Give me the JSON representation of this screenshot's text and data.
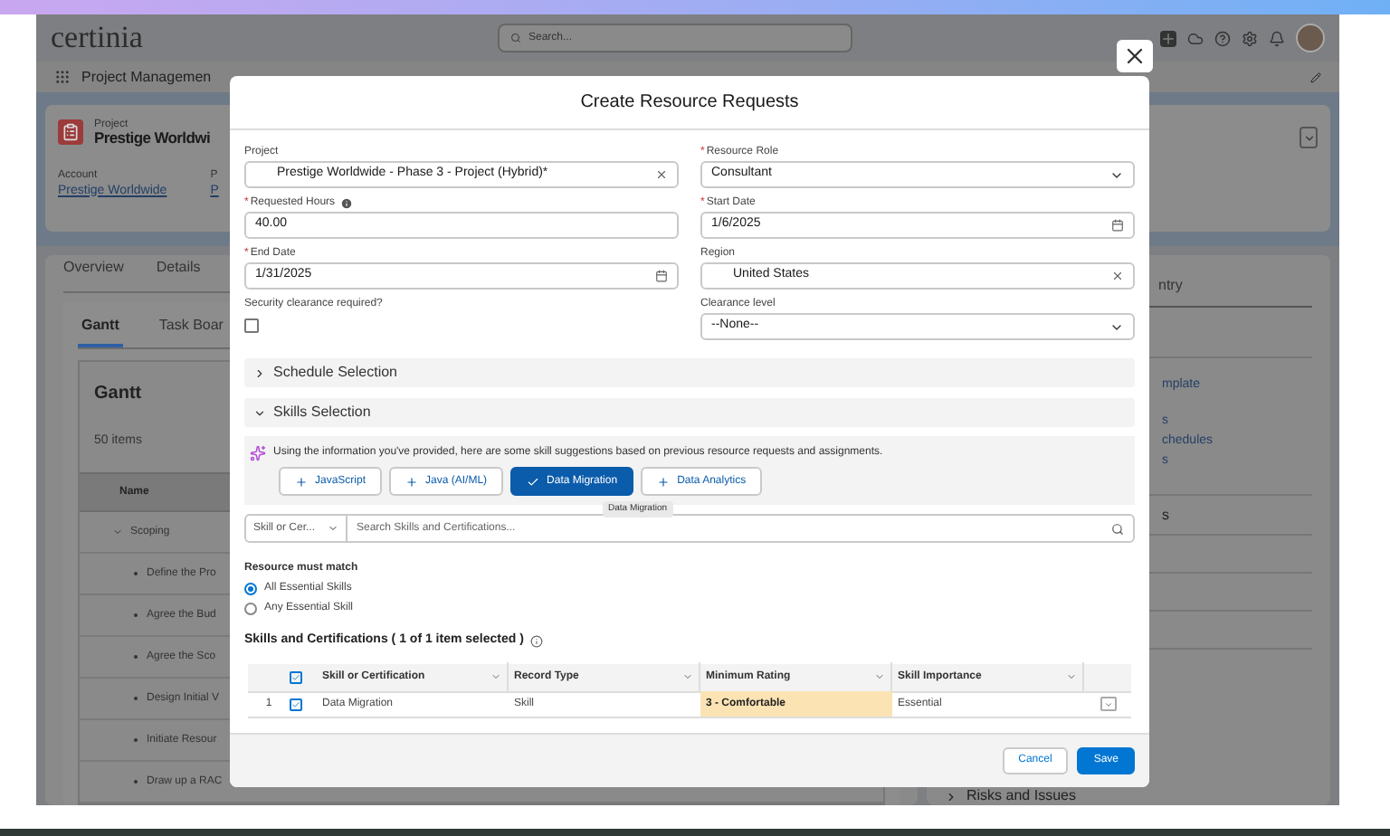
{
  "top_bar": {
    "logo": "certinia",
    "search": {
      "placeholder": "Search..."
    }
  },
  "nav": {
    "app_name": "Project Managemen"
  },
  "record_header": {
    "object_label": "Project",
    "title": "Prestige Worldwi",
    "fields": [
      {
        "label": "Account",
        "value": "Prestige Worldwide"
      },
      {
        "label": "P",
        "value": "P"
      }
    ]
  },
  "left_panel": {
    "tabs": [
      "Overview",
      "Details"
    ],
    "subtabs": [
      {
        "label": "Gantt",
        "selected": true
      },
      {
        "label": "Task Boar",
        "selected": false
      }
    ],
    "gantt": {
      "title": "Gantt",
      "count": "50 items",
      "column": "Name",
      "rows": [
        {
          "name": "Scoping",
          "expanded": true,
          "children": [
            {
              "name": "Define the Pro"
            },
            {
              "name": "Agree the Bud"
            },
            {
              "name": "Agree the Sco"
            },
            {
              "name": "Design Initial V"
            },
            {
              "name": "Initiate Resour"
            },
            {
              "name": "Draw up a RAC"
            }
          ]
        }
      ]
    }
  },
  "right_panel": {
    "tab": "ntry",
    "items": [
      {
        "kind": "link",
        "text": "mplate"
      },
      {
        "kind": "link",
        "text": "s"
      },
      {
        "kind": "link",
        "text": "chedules"
      },
      {
        "kind": "link",
        "text": "s"
      },
      {
        "kind": "heading",
        "text": "s"
      }
    ],
    "section": "Risks and Issues"
  },
  "modal": {
    "title": "Create Resource Requests",
    "fields": [
      {
        "kind": "lookup",
        "label": "Project",
        "value": "Prestige Worldwide - Phase 3 - Project (Hybrid)*"
      },
      {
        "kind": "select",
        "label": "Resource Role",
        "required_mark": "*",
        "value": "Consultant"
      },
      {
        "kind": "text",
        "label": "Requested Hours",
        "required_mark": "*",
        "info": true,
        "value": "40.00"
      },
      {
        "kind": "date",
        "label": "Start Date",
        "required_mark": "*",
        "value": "1/6/2025"
      },
      {
        "kind": "date",
        "label": "End Date",
        "required_mark": "*",
        "value": "1/31/2025"
      },
      {
        "kind": "lookup",
        "label": "Region",
        "value": "United States"
      },
      {
        "kind": "checkbox",
        "label": "Security clearance required?",
        "checked": false
      },
      {
        "kind": "select",
        "label": "Clearance level",
        "value": "--None--"
      }
    ],
    "sections": [
      {
        "title": "Schedule Selection",
        "expanded": false
      },
      {
        "title": "Skills Selection",
        "expanded": true
      }
    ],
    "suggestions": {
      "text": "Using the information you've provided, here are some skill suggestions based on previous resource requests and assignments.",
      "skills": [
        {
          "label": "JavaScript",
          "selected": false
        },
        {
          "label": "Java (AI/ML)",
          "selected": false
        },
        {
          "label": "Data Migration",
          "selected": true
        },
        {
          "label": "Data Analytics",
          "selected": false
        }
      ]
    },
    "skill_search": {
      "type_filter": "Skill or Cer...",
      "placeholder": "Search Skills and Certifications...",
      "tooltip": "Data Migration"
    },
    "match": {
      "label": "Resource must match",
      "options": [
        {
          "label": "All Essential Skills",
          "selected": true
        },
        {
          "label": "Any Essential Skill",
          "selected": false
        }
      ]
    },
    "table": {
      "title": "Skills and Certifications ( 1 of 1 item selected )",
      "info": true,
      "all_checked": true,
      "columns": [
        "Skill or Certification",
        "Record Type",
        "Minimum Rating",
        "Skill Importance"
      ],
      "rows": [
        {
          "number": "1",
          "checked": true,
          "cells": [
            {
              "text": "Data Migration",
              "edited": false
            },
            {
              "text": "Skill",
              "edited": false
            },
            {
              "text": "3 - Comfortable",
              "edited": true
            },
            {
              "text": "Essential",
              "edited": false
            }
          ]
        }
      ]
    },
    "buttons": [
      {
        "label": "Cancel",
        "kind": "neutral"
      },
      {
        "label": "Save",
        "kind": "brand"
      }
    ]
  }
}
